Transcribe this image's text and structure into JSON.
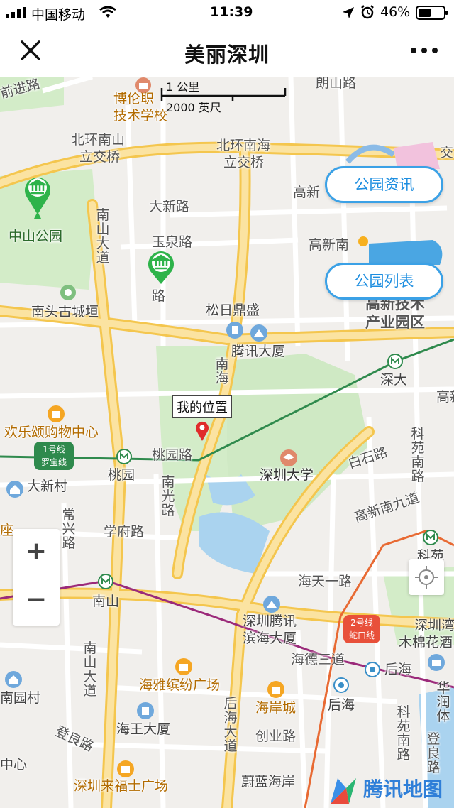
{
  "status": {
    "carrier": "中国移动",
    "time": "11:39",
    "battery": "46%"
  },
  "nav": {
    "title": "美丽深圳"
  },
  "scale": {
    "km": "1 公里",
    "ft": "2000 英尺"
  },
  "buttons": {
    "news": "公园资讯",
    "list": "公园列表",
    "zoom_in": "+",
    "zoom_out": "−"
  },
  "my_location": "我的位置",
  "metro": {
    "line1_name": "1号线",
    "line1_alt": "罗宝线",
    "line2_name": "2号线",
    "line2_alt": "蛇口线"
  },
  "brand": "腾讯地图",
  "labels": {
    "qianjin": "前进路",
    "bolun": "博伦职",
    "bolun2": "技术学校",
    "langshan": "朗山路",
    "beihuan_ns": "北环南山",
    "beihuan_ns2": "立交桥",
    "beihuan_nh": "北环南海",
    "beihuan_nh2": "立交桥",
    "jiao": "交",
    "zhongshan": "中山公园",
    "daxin_rd": "大新路",
    "gaoxin1": "高新",
    "gaoxin2": "高新南",
    "nanshan_dadao": "南山大道",
    "yuquan": "玉泉路",
    "lu": "路",
    "nantou": "南头古城垣",
    "songri": "松日鼎盛",
    "gaoxintech": "高新技术",
    "gaoxintech2": "产业园区",
    "tencent": "腾讯大厦",
    "nanhai": "南海",
    "shenda": "深大",
    "gao3": "高新",
    "huanle": "欢乐颂购物中心",
    "taoyuan_rd": "桃园路",
    "taoyuan": "桃园",
    "szu": "深圳大学",
    "baishi": "白石路",
    "keyuan": "科苑南路",
    "daxin_cun": "大新村",
    "nanguang": "南光路",
    "gaoxin9": "高新南九道",
    "changxing": "常兴路",
    "xuefu": "学府路",
    "zuo": "座",
    "ke": "科苑",
    "haitian": "海天一路",
    "nanshan": "南山",
    "txbinhai": "深圳腾讯",
    "txbinhai2": "滨海大厦",
    "shenzhenwan": "深圳湾",
    "mumian": "木棉花酒",
    "haide3": "海德三道",
    "houhai1": "后海",
    "nanshan_dadao2": "南山大道",
    "haiya": "海雅缤纷广场",
    "haian": "海岸城",
    "houhai2": "后海",
    "huati": "华润体",
    "nanyuan": "南园村",
    "houhai_dadao": "后海大道",
    "haiwang": "海王大厦",
    "chuangye": "创业路",
    "dengliang": "登良路",
    "keyuan2": "科苑南路",
    "dengliang2": "登良路",
    "zhongxin": "中心",
    "laifushi": "深圳来福士广场",
    "weilan": "蔚蓝海岸"
  },
  "colors": {
    "accent": "#1d8ee0",
    "park": "#d3ecc8",
    "water": "#aad3ef",
    "major_road": "#fbd66a",
    "pin": "#e02b2b",
    "metro_green": "#2f8a4d",
    "metro_red": "#e8503a"
  }
}
